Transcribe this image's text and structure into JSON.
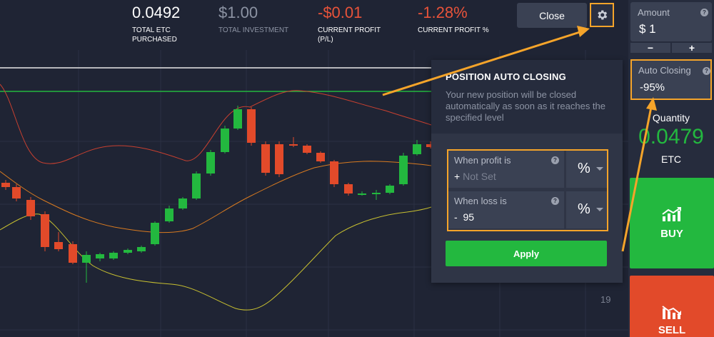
{
  "stats": [
    {
      "value": "0.0492",
      "label_line1": "TOTAL ETC",
      "label_line2": "PURCHASED",
      "value_color": "#ffffff",
      "label_color": "#ffffff"
    },
    {
      "value": "$1.00",
      "label_line1": "TOTAL INVESTMENT",
      "label_line2": "",
      "value_color": "#8c93a3",
      "label_color": "#8c93a3"
    },
    {
      "value": "-$0.01",
      "label_line1": "CURRENT PROFIT",
      "label_line2": "(P/L)",
      "value_color": "#e8533a",
      "label_color": "#ffffff"
    },
    {
      "value": "-1.28%",
      "label_line1": "CURRENT PROFIT %",
      "label_line2": "",
      "value_color": "#e8533a",
      "label_color": "#ffffff"
    }
  ],
  "toolbar": {
    "close_label": "Close"
  },
  "sidebar": {
    "amount_label": "Amount",
    "amount_value": "$ 1",
    "stepper_minus": "−",
    "stepper_plus": "+",
    "auto_closing_label": "Auto Closing",
    "auto_closing_value": "-95%",
    "quantity_label": "Quantity",
    "quantity_value": "0.0479",
    "quantity_unit": "ETC",
    "buy_label": "BUY",
    "sell_label": "SELL"
  },
  "popup": {
    "title": "POSITION AUTO CLOSING",
    "description": "Your new position will be closed automatically as soon as it reaches the specified level",
    "profit_label": "When profit is",
    "profit_sign": "+",
    "profit_placeholder": "Not Set",
    "profit_unit": "%",
    "loss_label": "When loss is",
    "loss_sign": "-",
    "loss_value": "95",
    "loss_unit": "%",
    "apply_label": "Apply"
  },
  "chart": {
    "axis_label": "19",
    "colors": {
      "up": "#23b83f",
      "down": "#e24a2a",
      "background": "#1f2434",
      "accent": "#f5a42a"
    }
  }
}
